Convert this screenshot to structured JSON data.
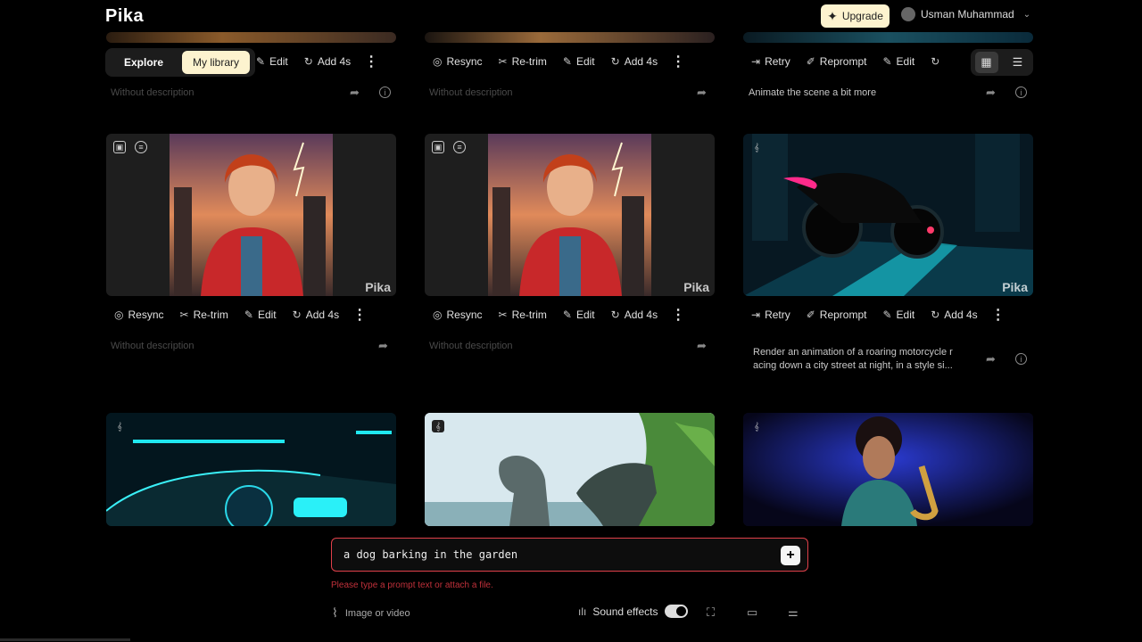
{
  "app": {
    "logo": "Pika"
  },
  "header": {
    "upgrade_label": "Upgrade",
    "user_name": "Usman Muhammad"
  },
  "tabs": {
    "explore": "Explore",
    "library": "My library"
  },
  "watermark": "Pika",
  "actions": {
    "resync": "Resync",
    "retrim": "Re-trim",
    "edit": "Edit",
    "add4s": "Add 4s",
    "retry": "Retry",
    "reprompt": "Reprompt"
  },
  "descriptions": {
    "none": "Without description",
    "row1_col3": "Animate the scene a bit more",
    "row2_col3_line1": "Render an animation of a roaring motorcycle r",
    "row2_col3_line2": "acing down a city street at night, in a style si..."
  },
  "prompt": {
    "value": "a dog barking in the garden",
    "error": "Please type a prompt text or attach a file."
  },
  "footer": {
    "attach_label": "Image or video",
    "sound_label": "Sound effects",
    "sound_on": true
  },
  "colors": {
    "accent": "#fdf3cf",
    "error": "#e0404a",
    "bg": "#000000"
  }
}
